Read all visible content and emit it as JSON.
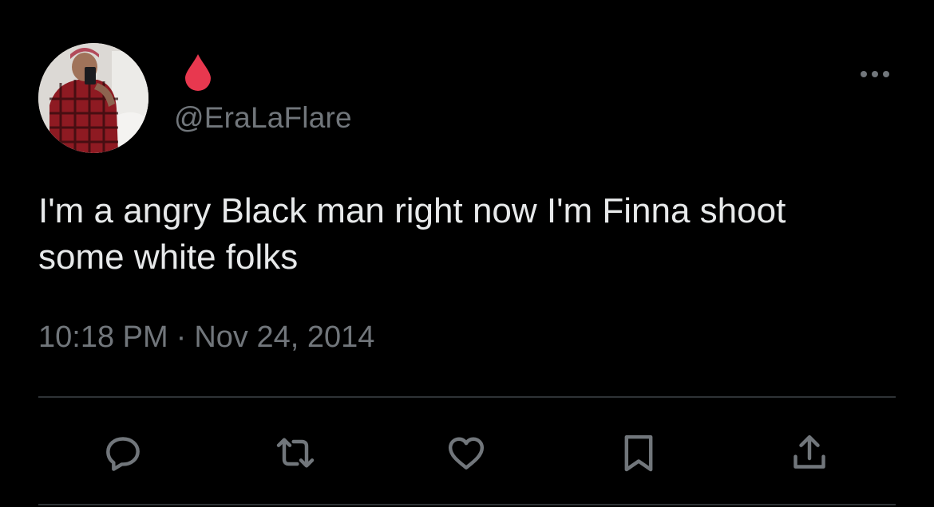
{
  "tweet": {
    "display_name_icon": "blood-drop-icon",
    "handle": "@EraLaFlare",
    "text": "I'm a angry Black man right now I'm Finna shoot\nsome white folks",
    "time": "10:18 PM",
    "separator": "·",
    "date": "Nov 24, 2014"
  },
  "actions": [
    {
      "name": "reply",
      "icon": "reply-icon"
    },
    {
      "name": "retweet",
      "icon": "retweet-icon"
    },
    {
      "name": "like",
      "icon": "heart-icon"
    },
    {
      "name": "bookmark",
      "icon": "bookmark-icon"
    },
    {
      "name": "share",
      "icon": "share-icon"
    }
  ],
  "colors": {
    "background": "#000000",
    "primary_text": "#e7e9ea",
    "secondary_text": "#71767b",
    "divider": "#2f3336",
    "drop_red": "#e8384f"
  }
}
